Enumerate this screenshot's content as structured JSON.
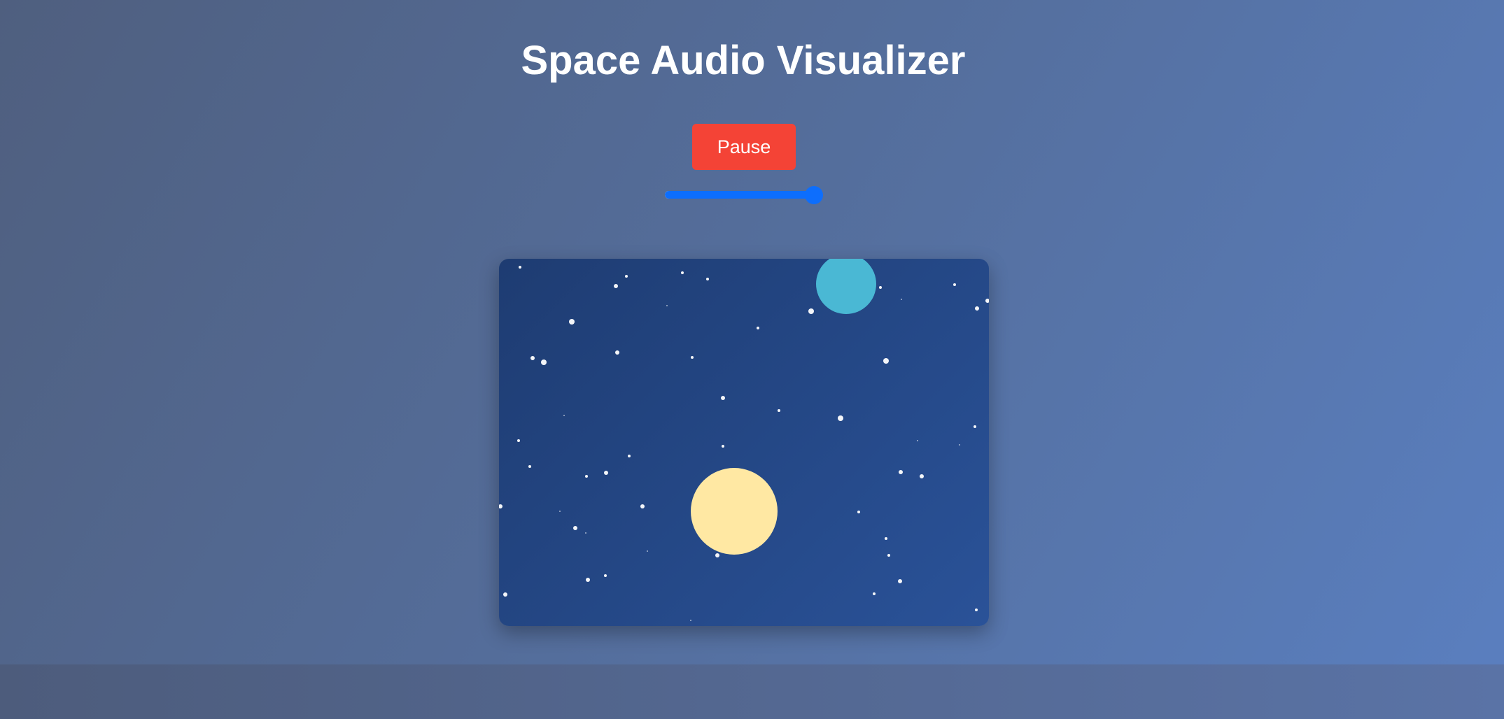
{
  "page": {
    "title": "Space Audio Visualizer"
  },
  "controls": {
    "pause_label": "Pause",
    "volume_level": 0.97,
    "accent_color": "#0d6efd",
    "pause_color": "#f44336"
  },
  "visualizer": {
    "background_colors": [
      "#1e3c72",
      "#2a5298"
    ],
    "planet_colors": [
      "#4ab8d4",
      "#ffe8a3"
    ],
    "star_color": "#ffffff"
  }
}
